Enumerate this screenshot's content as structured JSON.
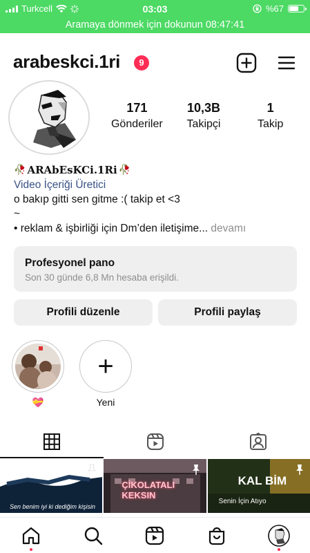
{
  "status_bar": {
    "carrier": "Turkcell",
    "time": "03:03",
    "battery": "%67",
    "battery_level": 0.67,
    "call_banner": "Aramaya dönmek için dokunun 08:47:41"
  },
  "header": {
    "username": "arabeskci.1ri",
    "notification_count": "9",
    "icons": [
      "plus-square-icon",
      "hamburger-menu-icon"
    ]
  },
  "stats": [
    {
      "value": "171",
      "label": "Gönderiler"
    },
    {
      "value": "10,3B",
      "label": "Takipçi"
    },
    {
      "value": "1",
      "label": "Takip"
    }
  ],
  "bio": {
    "display_name": "ARAbEsKCi.1Ri",
    "category": "Video İçeriği Üretici",
    "line1": "o bakıp gitti sen gitme :( takip et <3",
    "line2": "~",
    "line3": "• reklam & işbirliği için Dm’den iletişime...",
    "more": "devamı"
  },
  "dashboard": {
    "title": "Profesyonel pano",
    "subtitle": "Son 30 günde 6,8 Mn hesaba erişildi."
  },
  "buttons": {
    "edit": "Profili düzenle",
    "share": "Profili paylaş"
  },
  "highlights": [
    {
      "label": "💝"
    },
    {
      "label": "Yeni"
    }
  ],
  "tabs": [
    "grid-icon",
    "reels-icon",
    "tagged-icon"
  ],
  "posts": [
    {
      "caption": "Sen benim iyi ki dediğim kişisin"
    },
    {
      "caption": "ÇİKOLATALI KEKSIN"
    },
    {
      "caption": "KAL BİM",
      "sub": "Senin İçin Atıyo"
    }
  ],
  "bottom_nav": [
    "home-icon",
    "search-icon",
    "reels-icon",
    "shop-icon",
    "profile-avatar"
  ],
  "colors": {
    "status_green": "#4cd964",
    "badge_red": "#ff2d55",
    "category_blue": "#385185"
  }
}
